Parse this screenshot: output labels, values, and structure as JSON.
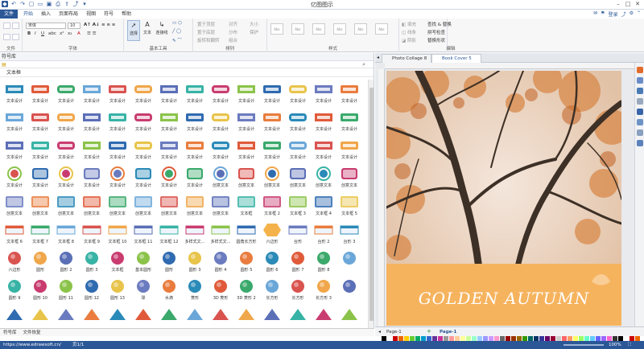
{
  "window": {
    "title": "亿图图示"
  },
  "menu": {
    "file": "文件",
    "tabs": [
      "开始",
      "插入",
      "页面布局",
      "视图",
      "符号",
      "帮助"
    ],
    "login": "登录"
  },
  "ribbon": {
    "groups": [
      "文件",
      "字体",
      "基本工具",
      "排列",
      "样式",
      "编辑"
    ],
    "font_name": "宋体",
    "font_size": "10",
    "tools": [
      "选择",
      "文本",
      "连接线"
    ],
    "arrange": [
      "置于顶层",
      "置于底层",
      "旋转和翻转",
      "对齐",
      "分布",
      "组合",
      "大小",
      "保护"
    ],
    "edit": [
      "查找 & 替换",
      "拼写检查",
      "替换形状"
    ],
    "style_swatches": [
      "Abc",
      "Abc",
      "Abc",
      "Abc",
      "Abc",
      "Abc"
    ]
  },
  "library": {
    "title": "符号库",
    "section": "文本框",
    "footer": [
      "符号库",
      "文件恢复"
    ],
    "rows": [
      [
        "文本设计",
        "文本设计",
        "文本设计",
        "文本设计",
        "文本设计",
        "文本设计",
        "文本设计",
        "文本设计",
        "文本设计",
        "文本设计",
        "文本设计",
        "文本设计",
        "文本设计",
        "文本设计"
      ],
      [
        "文本设计",
        "文本设计",
        "文本设计",
        "文本设计",
        "文本设计",
        "文本设计",
        "文本设计",
        "文本设计",
        "文本设计",
        "文本设计",
        "文本设计",
        "文本设计",
        "文本设计",
        "文本设计"
      ],
      [
        "文本设计",
        "文本设计",
        "文本设计",
        "文本设计",
        "文本设计",
        "文本设计",
        "文本设计",
        "文本设计",
        "文本设计",
        "文本设计",
        "文本设计",
        "文本设计",
        "文本设计",
        "文本设计"
      ],
      [
        "文本设计",
        "文本设计",
        "文本设计",
        "文本设计",
        "文本设计",
        "文本设计",
        "文本设计",
        "文本设计",
        "创意文本",
        "创意文本",
        "创意文本",
        "创意文本",
        "创意文本",
        "创意文本"
      ],
      [
        "创意文本",
        "创意文本",
        "创意文本",
        "创意文本",
        "创意文本",
        "创意文本",
        "创意文本",
        "创意文本",
        "创意文本",
        "文本框",
        "文本框 2",
        "文本框 3",
        "文本框 4",
        "文本框 5"
      ],
      [
        "文本框 6",
        "文本框 7",
        "文本框 8",
        "文本框 9",
        "文本框 10",
        "文本框 11",
        "文本框 12",
        "多样式文...",
        "多样式文...",
        "圆角长方形",
        "六边形",
        "台形",
        "台形 2",
        "台形 3"
      ],
      [
        "六边形",
        "圆形",
        "圆形 2",
        "圆形 3",
        "文本框",
        "基本圆形",
        "圆形",
        "圆形 3",
        "圆形 4",
        "圆形 5",
        "圆形 6",
        "圆形 7",
        "圆形 8",
        ""
      ],
      [
        "圆形 9",
        "圆形 10",
        "圆形 11",
        "圆形 12",
        "圆形 13",
        "球",
        "水滴",
        "菱形",
        "3D 菱形",
        "3D 菱形 2",
        "长方形",
        "长方形",
        "长方形 3",
        ""
      ],
      [
        "",
        "",
        "",
        "",
        "",
        "",
        "",
        "",
        "",
        "",
        "",
        "",
        "",
        ""
      ]
    ]
  },
  "canvas": {
    "tabs": [
      "Photo Collage 8",
      "Book Cover 5"
    ],
    "banner_text": "GOLDEN AUTUMN",
    "page_tabs": [
      "Page-1",
      "Page-1"
    ]
  },
  "status": {
    "url": "https://www.edrawsoft.cn/",
    "page": "页1/1",
    "zoom": "100%"
  }
}
